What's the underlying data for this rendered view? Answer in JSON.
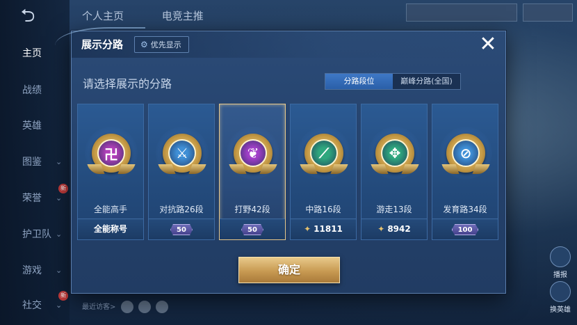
{
  "sidebar": {
    "items": [
      {
        "label": "主页",
        "chevron": false,
        "new": false,
        "active": true
      },
      {
        "label": "战绩",
        "chevron": false,
        "new": false,
        "active": false
      },
      {
        "label": "英雄",
        "chevron": false,
        "new": false,
        "active": false
      },
      {
        "label": "图鉴",
        "chevron": true,
        "new": false,
        "active": false
      },
      {
        "label": "荣誉",
        "chevron": true,
        "new": true,
        "active": false
      },
      {
        "label": "护卫队",
        "chevron": true,
        "new": false,
        "active": false
      },
      {
        "label": "游戏",
        "chevron": true,
        "new": false,
        "active": false
      },
      {
        "label": "社交",
        "chevron": true,
        "new": true,
        "active": false
      }
    ],
    "new_badge": "新"
  },
  "top_tabs": [
    "个人主页",
    "电竞主推"
  ],
  "bottom": {
    "recent_visitors": "最近访客>"
  },
  "right_buttons": {
    "first": "播报",
    "second": "换英雄"
  },
  "modal": {
    "title": "展示分路",
    "priority_label": "优先显示",
    "close_symbol": "✕",
    "subtitle": "请选择展示的分路",
    "segment": [
      "分路段位",
      "巅峰分路(全国)"
    ],
    "confirm": "确定"
  },
  "cards": [
    {
      "label": "全能高手",
      "foot_type": "text",
      "foot": "全能称号",
      "emblem": "allround-icon",
      "glyph": "卍",
      "color": "#b03fb8"
    },
    {
      "label": "对抗路26段",
      "foot_type": "badge",
      "foot": "50",
      "emblem": "clash-lane-icon",
      "glyph": "⚔",
      "color": "#3f8fd6"
    },
    {
      "label": "打野42段",
      "foot_type": "badge",
      "foot": "50",
      "emblem": "jungle-icon",
      "glyph": "❦",
      "color": "#a13fc8",
      "selected": true
    },
    {
      "label": "中路16段",
      "foot_type": "gem",
      "foot": "11811",
      "emblem": "mid-lane-icon",
      "glyph": "⟋",
      "color": "#2fa77e"
    },
    {
      "label": "游走13段",
      "foot_type": "gem",
      "foot": "8942",
      "emblem": "roam-icon",
      "glyph": "✥",
      "color": "#2fa77e"
    },
    {
      "label": "发育路34段",
      "foot_type": "badge",
      "foot": "100",
      "emblem": "farm-lane-icon",
      "glyph": "⊘",
      "color": "#3f8fd6"
    }
  ]
}
